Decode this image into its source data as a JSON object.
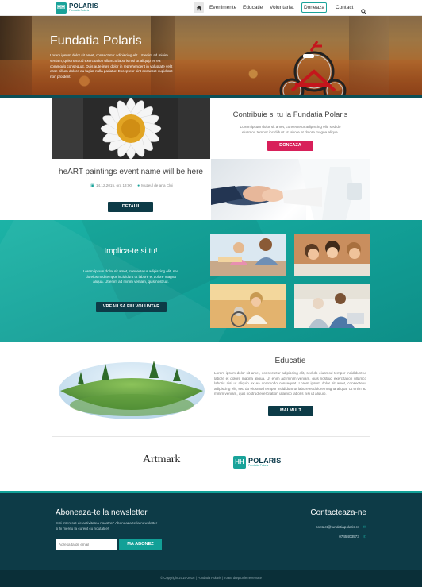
{
  "brand": {
    "logo_mark": "HH",
    "name": "POLARIS",
    "tagline": "Fundatia Polaris"
  },
  "nav": {
    "items": [
      "Evenimente",
      "Educatie",
      "Voluntariat"
    ],
    "donate_label": "Doneaza",
    "contact_label": "Contact"
  },
  "hero": {
    "title": "Fundatia Polaris",
    "text": "Lorem ipsum dolor sit amet, consectetur adipiscing elit. Ut enim ad minim veniam, quis nostrud exercitation ullamco laboris nisi ut aliquip ex ea commodo consequat. Duis aute irure dolor in reprehenderit in voluptate velit esse cillum dolore eu fugiat nulla pariatur. Excepteur sint occaecat cupidatat non proident."
  },
  "contribute": {
    "title": "Contribuie si tu la  Fundatia Polaris",
    "text": "Lorem ipsum dolor sit amet, consectetur adipiscing elit, sed do eiusmod tempor incididunt ut labore et dolore magna aliqua.",
    "button": "DONEAZA"
  },
  "event": {
    "title": "heART paintings event name will be here",
    "date": "14.12.2015, ora 13:00",
    "location": "Muzeul de arta Cluj",
    "button": "DETALII"
  },
  "involve": {
    "title": "Implica-te si tu!",
    "text": "Lorem ipsum dolor sit amet, consectetur adipiscing elit, sed do eiusmod tempor incididunt ut labore et dolore magna aliqua. Ut enim ad minim veniam, quis nostrud.",
    "button": "VREAU SA FIU VOLUNTAR"
  },
  "education": {
    "title": "Educatie",
    "text": "Lorem ipsum dolor sit amet, consectetur adipiscing elit, sed do eiusmod tempor incididunt ut labore et dolore magna aliqua. Ut enim ad minim veniam, quis nostrud exercitation ullamco laboris nisi ut aliquip ex ea commodo consequat. Lorem ipsum dolor sit amet, consectetur adipiscing elit, sed do eiusmod tempor incididunt ut labore et dolore magna aliqua. Ut enim ad minim veniam, quis nostrud exercitation ullamco laboris nisi ut aliquip.",
    "button": "MAI MULT"
  },
  "partners": {
    "artmark": "Artmark"
  },
  "newsletter": {
    "title": "Aboneaza-te la newsletter",
    "text": "Esti interesat de activitatea noastra? Aboneaza-te la newsletter si fii mereu la curent cu noutatile!",
    "placeholder": "Adresa ta de email",
    "button": "MA ABONEZ"
  },
  "contact": {
    "title": "Contacteaza-ne",
    "email": "contact@fundatiapolaris.ro",
    "phone": "0745403573"
  },
  "footer": {
    "copyright": "© Copyright 2015-2016   |   Fundatia Polaris   |   Toate drepturile rezervate"
  },
  "colors": {
    "accent": "#1aa39a",
    "dark": "#0d3b47",
    "pink": "#d8205a"
  }
}
